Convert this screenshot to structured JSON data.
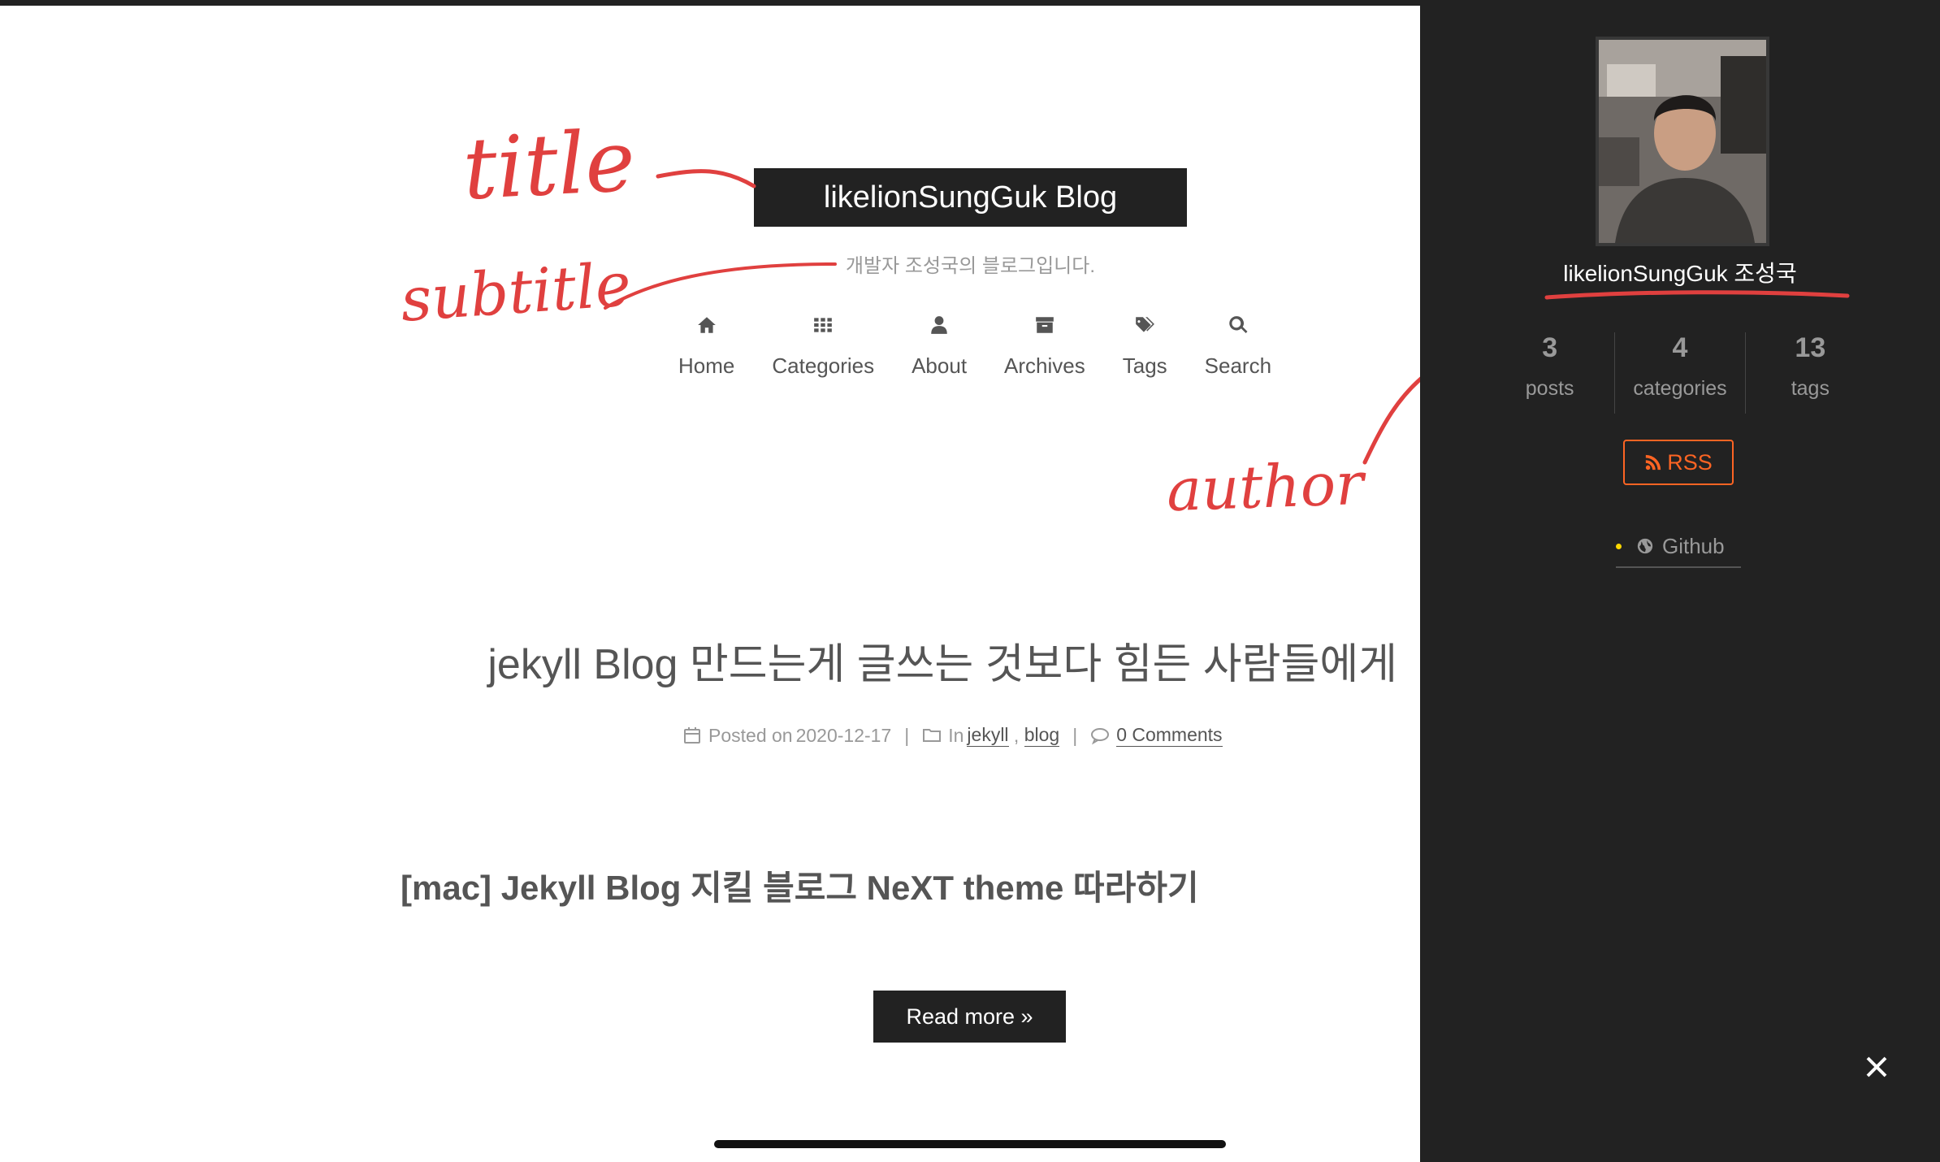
{
  "site": {
    "title": "likelionSungGuk Blog",
    "subtitle": "개발자 조성국의 블로그입니다."
  },
  "menu": [
    {
      "label": "Home",
      "icon": "home-icon"
    },
    {
      "label": "Categories",
      "icon": "grid-icon"
    },
    {
      "label": "About",
      "icon": "user-icon"
    },
    {
      "label": "Archives",
      "icon": "archive-icon"
    },
    {
      "label": "Tags",
      "icon": "tags-icon"
    },
    {
      "label": "Search",
      "icon": "search-icon"
    }
  ],
  "post": {
    "title": "jekyll Blog 만드는게 글쓰는 것보다 힘든 사람들에게",
    "posted_prefix": "Posted on",
    "date": "2020-12-17",
    "in_label": "In",
    "categories": [
      "jekyll",
      "blog"
    ],
    "comments": "0 Comments",
    "heading": "[mac] Jekyll Blog 지킬 블로그 NeXT theme 따라하기",
    "read_more": "Read more »"
  },
  "sidebar": {
    "author": "likelionSungGuk 조성국",
    "stats": [
      {
        "count": "3",
        "label": "posts"
      },
      {
        "count": "4",
        "label": "categories"
      },
      {
        "count": "13",
        "label": "tags"
      }
    ],
    "rss_label": "RSS",
    "links": [
      {
        "label": "Github",
        "icon": "globe-icon"
      }
    ]
  },
  "annotations": {
    "title": "title",
    "subtitle": "subtitle",
    "author": "author"
  },
  "colors": {
    "brand_bg": "#222222",
    "sidebar_bg": "#222222",
    "rss": "#fc6423",
    "annotation": "#e0403f",
    "text": "#555555"
  }
}
